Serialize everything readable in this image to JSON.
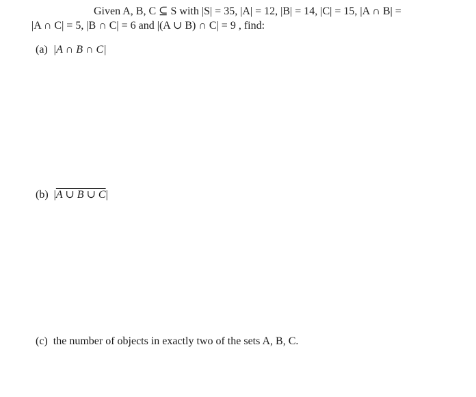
{
  "problem": {
    "line1": "Given A, B, C ⊆ S with |S| = 35, |A| = 12, |B| = 14, |C| = 15, |A ∩ B| =",
    "line2": "|A ∩ C| = 5, |B ∩ C| = 6 and |(A ∪ B) ∩ C| = 9 , find:"
  },
  "parts": {
    "a": {
      "label": "(a)",
      "expr": "|A ∩ B ∩ C|"
    },
    "b": {
      "label": "(b)",
      "bar_open": "|",
      "expr": "A ∪ B ∪ C",
      "bar_close": "|"
    },
    "c": {
      "label": "(c)",
      "text": "the number of objects in exactly two of the sets A, B, C."
    }
  }
}
